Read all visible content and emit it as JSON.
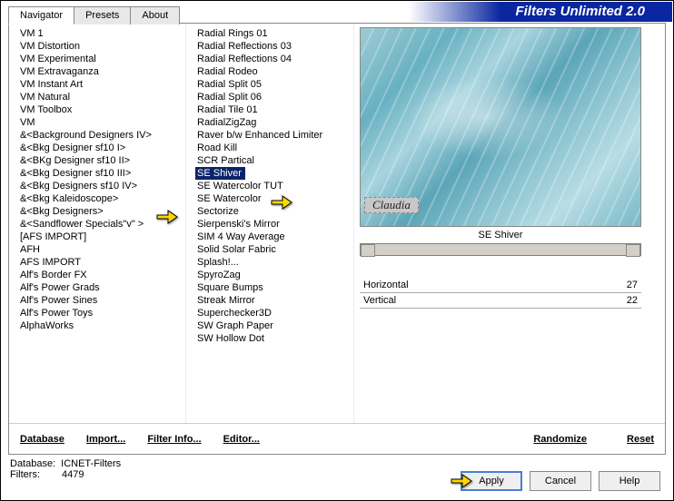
{
  "title": "Filters Unlimited 2.0",
  "tabs": {
    "navigator": "Navigator",
    "presets": "Presets",
    "about": "About"
  },
  "left_list": [
    "VM 1",
    "VM Distortion",
    "VM Experimental",
    "VM Extravaganza",
    "VM Instant Art",
    "VM Natural",
    "VM Toolbox",
    "VM",
    "&<Background Designers IV>",
    "&<Bkg Designer sf10 I>",
    "&<BKg Designer sf10 II>",
    "&<Bkg Designer sf10 III>",
    "&<Bkg Designers sf10 IV>",
    "&<Bkg Kaleidoscope>",
    "&<Bkg Designers>",
    "&<Sandflower Specials\"v\" >",
    "[AFS IMPORT]",
    "AFH",
    "AFS IMPORT",
    "Alf's Border FX",
    "Alf's Power Grads",
    "Alf's Power Sines",
    "Alf's Power Toys",
    "AlphaWorks"
  ],
  "left_selected_index": 11,
  "mid_list": [
    "Radial  Rings 01",
    "Radial Reflections 03",
    "Radial Reflections 04",
    "Radial Rodeo",
    "Radial Split 05",
    "Radial Split 06",
    "Radial Tile 01",
    "RadialZigZag",
    "Raver b/w Enhanced Limiter",
    "Road Kill",
    "SCR  Partical",
    "SE Shiver",
    "SE Watercolor TUT",
    "SE Watercolor",
    "Sectorize",
    "Sierpenski's Mirror",
    "SIM 4 Way Average",
    "Solid Solar Fabric",
    "Splash!...",
    "SpyroZag",
    "Square Bumps",
    "Streak Mirror",
    "Superchecker3D",
    "SW Graph Paper",
    "SW Hollow Dot"
  ],
  "mid_selected_index": 11,
  "preview_caption": "SE Shiver",
  "watermark": "Claudia",
  "params": [
    {
      "label": "Horizontal",
      "value": "27"
    },
    {
      "label": "Vertical",
      "value": "22"
    }
  ],
  "toolbar": {
    "database": "Database",
    "import": "Import...",
    "filter_info": "Filter Info...",
    "editor": "Editor...",
    "randomize": "Randomize",
    "reset": "Reset"
  },
  "footer": {
    "db_label": "Database:",
    "db_value": "ICNET-Filters",
    "filters_label": "Filters:",
    "filters_value": "4479"
  },
  "buttons": {
    "apply": "Apply",
    "cancel": "Cancel",
    "help": "Help"
  }
}
